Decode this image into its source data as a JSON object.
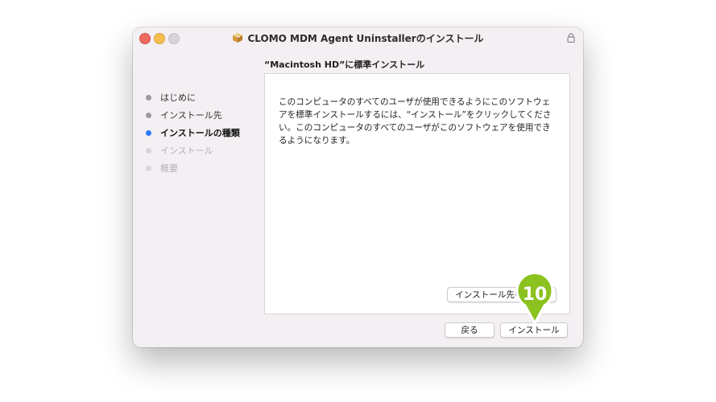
{
  "window": {
    "title": "CLOMO MDM Agent Uninstallerのインストール"
  },
  "heading": "“Macintosh HD”に標準インストール",
  "sidebar": {
    "steps": [
      {
        "label": "はじめに",
        "state": "done"
      },
      {
        "label": "インストール先",
        "state": "done"
      },
      {
        "label": "インストールの種類",
        "state": "current"
      },
      {
        "label": "インストール",
        "state": "future"
      },
      {
        "label": "概要",
        "state": "future"
      }
    ]
  },
  "main": {
    "description": "このコンピュータのすべてのユーザが使用できるようにこのソフトウェアを標準インストールするには、“インストール”をクリックしてください。このコンピュータのすべてのユーザがこのソフトウェアを使用できるようになります。",
    "change_location_label": "インストール先を変更..."
  },
  "footer": {
    "back_label": "戻る",
    "install_label": "インストール"
  },
  "marker": {
    "number": "10",
    "color": "#8cc21f"
  },
  "colors": {
    "accent": "#2f7cf6",
    "close": "#ed6a5e",
    "minimize": "#f5bf4f"
  }
}
